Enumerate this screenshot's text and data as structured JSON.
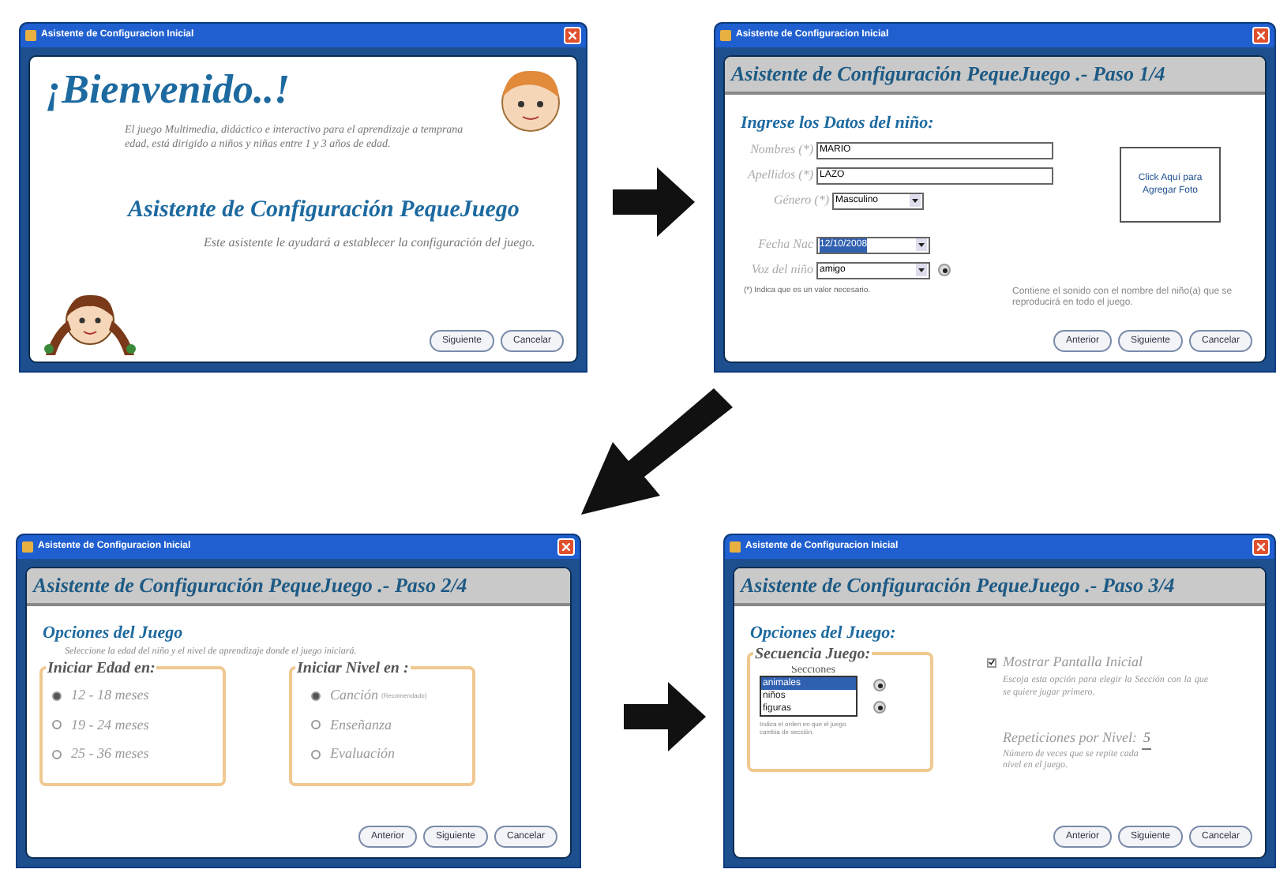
{
  "windows": [
    {
      "kind": "welcome",
      "title": "Asistente de Configuracion Inicial",
      "heading": "¡Bienvenido..!",
      "intro": "El juego Multimedia, didáctico e interactivo para el aprendizaje a temprana edad, está dirigido a niños y niñas entre 1 y 3 años de edad.",
      "subtitle": "Asistente de Configuración PequeJuego",
      "description": "Este asistente le ayudará a establecer la configuración del juego.",
      "buttons": [
        "Siguiente",
        "Cancelar"
      ]
    },
    {
      "kind": "child_data",
      "title": "Asistente de Configuracion Inicial",
      "header": "Asistente de Configuración  PequeJuego .-  Paso 1/4",
      "section": "Ingrese los Datos del niño:",
      "fields": [
        {
          "kind": "text",
          "label": "Nombres (*)",
          "value": "MARIO"
        },
        {
          "kind": "text",
          "label": "Apellidos (*)",
          "value": "LAZO"
        },
        {
          "kind": "select",
          "label": "Género (*)",
          "value": "Masculino"
        },
        {
          "kind": "date",
          "label": "Fecha Nac",
          "value": "12/10/2008"
        },
        {
          "kind": "voice",
          "label": "Voz del niño",
          "value": "amigo"
        }
      ],
      "voice_hint": "Contiene el sonido con el nombre del niño(a) que se reproducirá en todo el juego.",
      "photo": "Click Aquí para Agregar Foto",
      "footnote": "(*) Indica que es un valor necesario.",
      "buttons": [
        "Anterior",
        "Siguiente",
        "Cancelar"
      ]
    },
    {
      "kind": "start_options",
      "title": "Asistente de Configuracion Inicial",
      "header": "Asistente de Configuración  PequeJuego .-  Paso 2/4",
      "section": "Opciones del Juego",
      "hint": "Seleccione la edad del niño y el nivel de aprendizaje donde el juego iniciará.",
      "groups": [
        {
          "legend": "Iniciar Edad en:",
          "options": [
            {
              "label": "12 - 18 meses",
              "selected": true
            },
            {
              "label": "19 - 24 meses",
              "selected": false
            },
            {
              "label": "25 - 36 meses",
              "selected": false
            }
          ]
        },
        {
          "legend": "Iniciar Nivel en :",
          "options": [
            {
              "label": "Canción",
              "note": "(Recomendado)",
              "selected": true
            },
            {
              "label": "Enseñanza",
              "selected": false
            },
            {
              "label": "Evaluación",
              "selected": false
            }
          ]
        }
      ],
      "buttons": [
        "Anterior",
        "Siguiente",
        "Cancelar"
      ]
    },
    {
      "kind": "sequence",
      "title": "Asistente de Configuracion Inicial",
      "header": "Asistente de Configuración  PequeJuego .-  Paso 3/4",
      "section": "Opciones del Juego:",
      "legend": "Secuencia Juego:",
      "list_title": "Secciones",
      "items": [
        {
          "label": "animales",
          "selected": true
        },
        {
          "label": "niños",
          "selected": false
        },
        {
          "label": "figuras",
          "selected": false
        }
      ],
      "order_hint": "Indica el orden en que el juego cambia de sección.",
      "checkbox": {
        "label": "Mostrar Pantalla Inicial",
        "checked": true,
        "hint": "Escoja esta opción para elegir la Sección con la que se quiere jugar primero."
      },
      "repetitions": {
        "label": "Repeticiones por Nivel:",
        "value": "5",
        "hint": "Número de veces que se repite cada nivel en el juego."
      },
      "buttons": [
        "Anterior",
        "Siguiente",
        "Cancelar"
      ]
    }
  ]
}
